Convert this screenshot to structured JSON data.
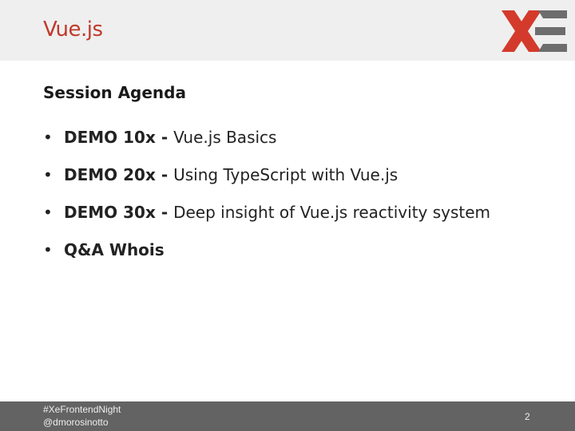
{
  "header": {
    "title": "Vue.js",
    "logo_icon": "xe-logo-icon",
    "logo_colors": {
      "red": "#d33a2c",
      "gray": "#6d6d6d"
    }
  },
  "content": {
    "section_title": "Session Agenda",
    "items": [
      {
        "bold": "DEMO 10x - ",
        "text": "Vue.js Basics"
      },
      {
        "bold": "DEMO 20x - ",
        "text": "Using TypeScript with Vue.js"
      },
      {
        "bold": "DEMO 30x - ",
        "text": "Deep insight of Vue.js reactivity system"
      },
      {
        "bold": "Q&A Whois",
        "text": ""
      }
    ],
    "bullet": "•"
  },
  "footer": {
    "hashtag": "#XeFrontendNight",
    "handle": "@dmorosinotto",
    "page_number": "2"
  },
  "colors": {
    "title": "#c0392b",
    "header_bg": "#efefef",
    "footer_bg": "#636363"
  }
}
